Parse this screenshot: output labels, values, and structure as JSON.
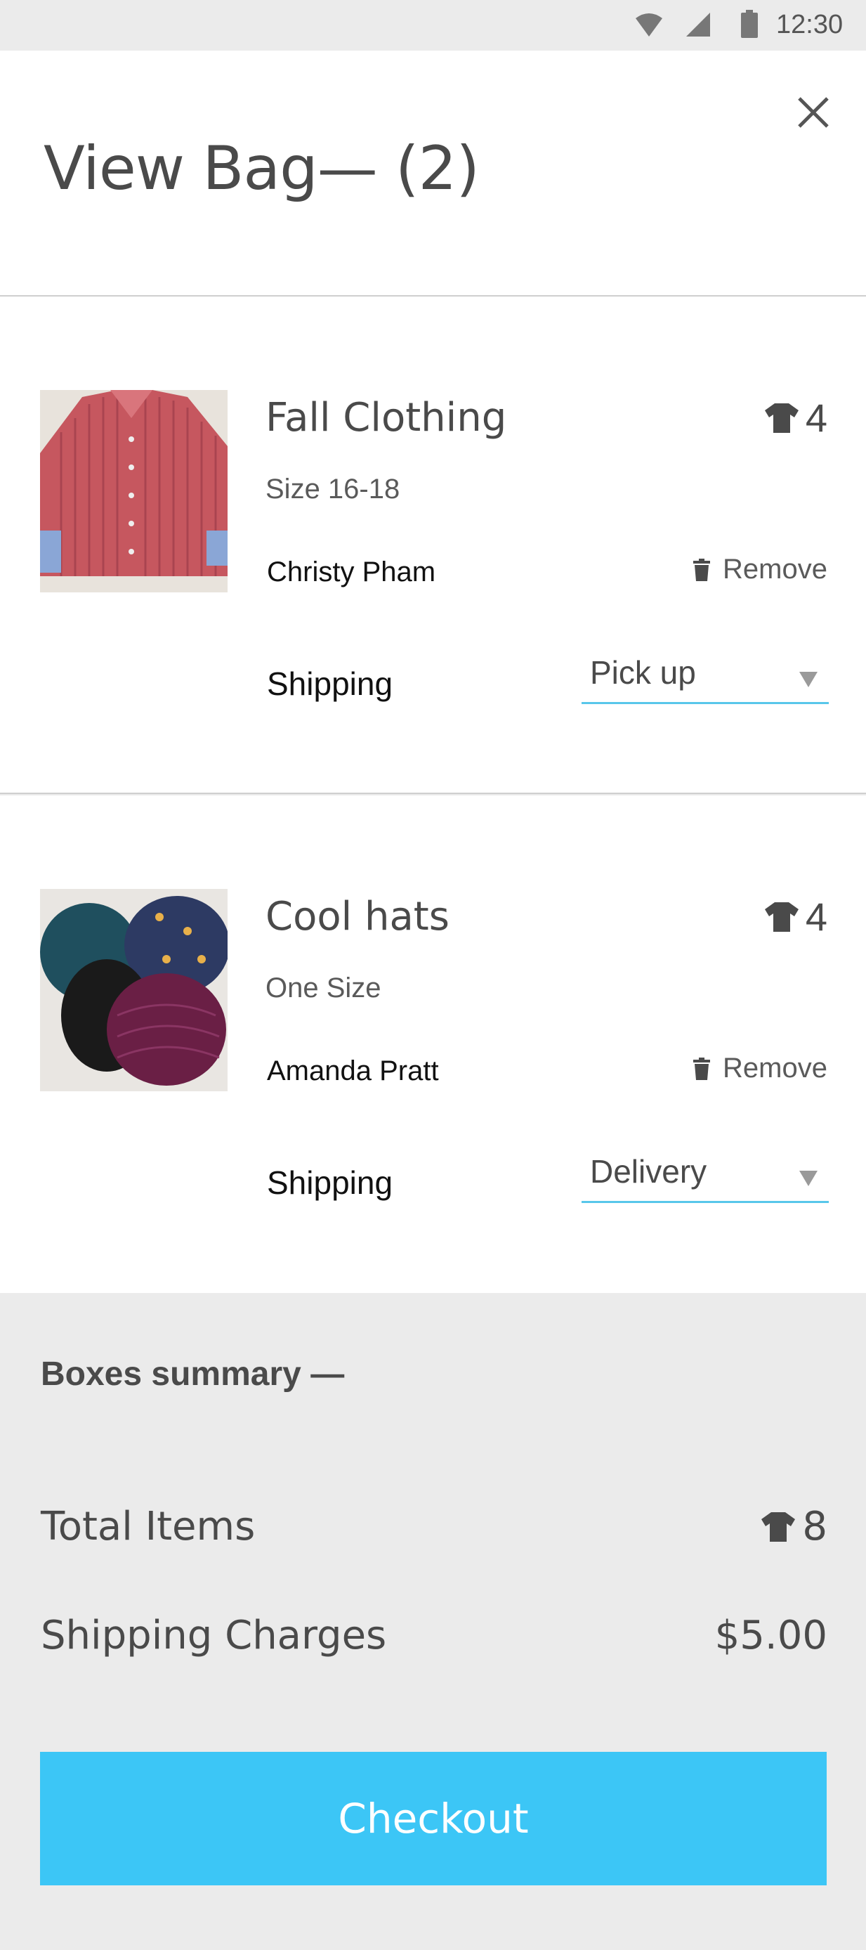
{
  "status_bar": {
    "time": "12:30"
  },
  "header": {
    "title": "View Bag— (2)"
  },
  "items": [
    {
      "name": "Fall Clothing",
      "size": "Size 16-18",
      "quantity": "4",
      "owner": "Christy Pham",
      "remove_label": "Remove",
      "shipping_label": "Shipping",
      "shipping_value": "Pick up",
      "image": "red striped shirt photo"
    },
    {
      "name": "Cool hats",
      "size": "One Size",
      "quantity": "4",
      "owner": "Amanda Pratt",
      "remove_label": "Remove",
      "shipping_label": "Shipping",
      "shipping_value": "Delivery",
      "image": "beanies and cap photo"
    }
  ],
  "summary": {
    "title": "Boxes summary —",
    "total_items_label": "Total Items",
    "total_items_value": "8",
    "shipping_charges_label": "Shipping Charges",
    "shipping_charges_value": "$5.00",
    "checkout_label": "Checkout"
  },
  "colors": {
    "accent": "#3cc6f6",
    "select_underline": "#58c7ea",
    "background": "#ebebeb"
  }
}
